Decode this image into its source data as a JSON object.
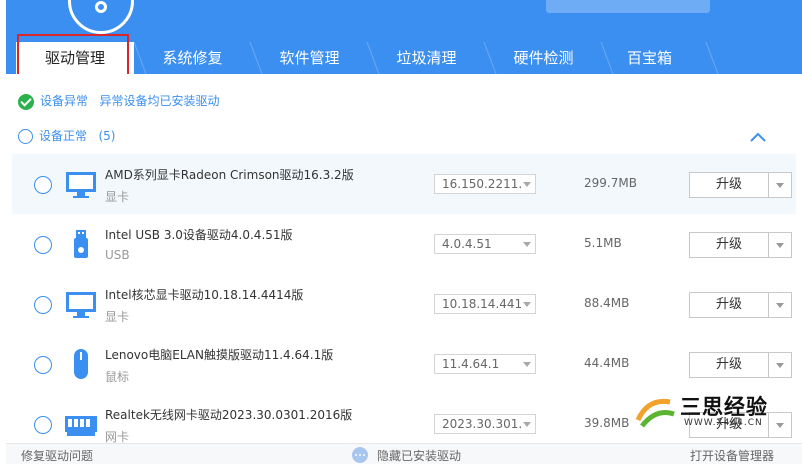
{
  "tabs": [
    {
      "label": "驱动管理",
      "active": true
    },
    {
      "label": "系统修复",
      "active": false
    },
    {
      "label": "软件管理",
      "active": false
    },
    {
      "label": "垃圾清理",
      "active": false
    },
    {
      "label": "硬件检测",
      "active": false
    },
    {
      "label": "百宝箱",
      "active": false
    }
  ],
  "sections": {
    "abnormal": {
      "label": "设备异常",
      "message": "异常设备均已安装驱动"
    },
    "normal": {
      "label": "设备正常",
      "count": "(5)"
    }
  },
  "devices": [
    {
      "name": "AMD系列显卡Radeon Crimson驱动16.3.2版",
      "type": "显卡",
      "version": "16.150.2211.",
      "size": "299.7MB",
      "action": "升级",
      "icon": "monitor-icon"
    },
    {
      "name": "Intel USB 3.0设备驱动4.0.4.51版",
      "type": "USB",
      "version": "4.0.4.51",
      "size": "5.1MB",
      "action": "升级",
      "icon": "usb-icon"
    },
    {
      "name": "Intel核芯显卡驱动10.18.14.4414版",
      "type": "显卡",
      "version": "10.18.14.441",
      "size": "88.4MB",
      "action": "升级",
      "icon": "monitor-icon"
    },
    {
      "name": "Lenovo电脑ELAN触摸版驱动11.4.64.1版",
      "type": "鼠标",
      "version": "11.4.64.1",
      "size": "44.4MB",
      "action": "升级",
      "icon": "mouse-icon"
    },
    {
      "name": "Realtek无线网卡驱动2023.30.0301.2016版",
      "type": "网卡",
      "version": "2023.30.301.",
      "size": "39.8MB",
      "action": "升级",
      "icon": "network-card-icon"
    }
  ],
  "footer": {
    "left": "修复驱动问题",
    "middle": "隐藏已安装驱动",
    "right": "打开设备管理器"
  },
  "watermark": {
    "text": "三思经验",
    "sub": "WWW.X444.CN"
  },
  "colors": {
    "accent": "#3b8ff0",
    "ok": "#2bb24c",
    "highlight": "#d9262c"
  }
}
